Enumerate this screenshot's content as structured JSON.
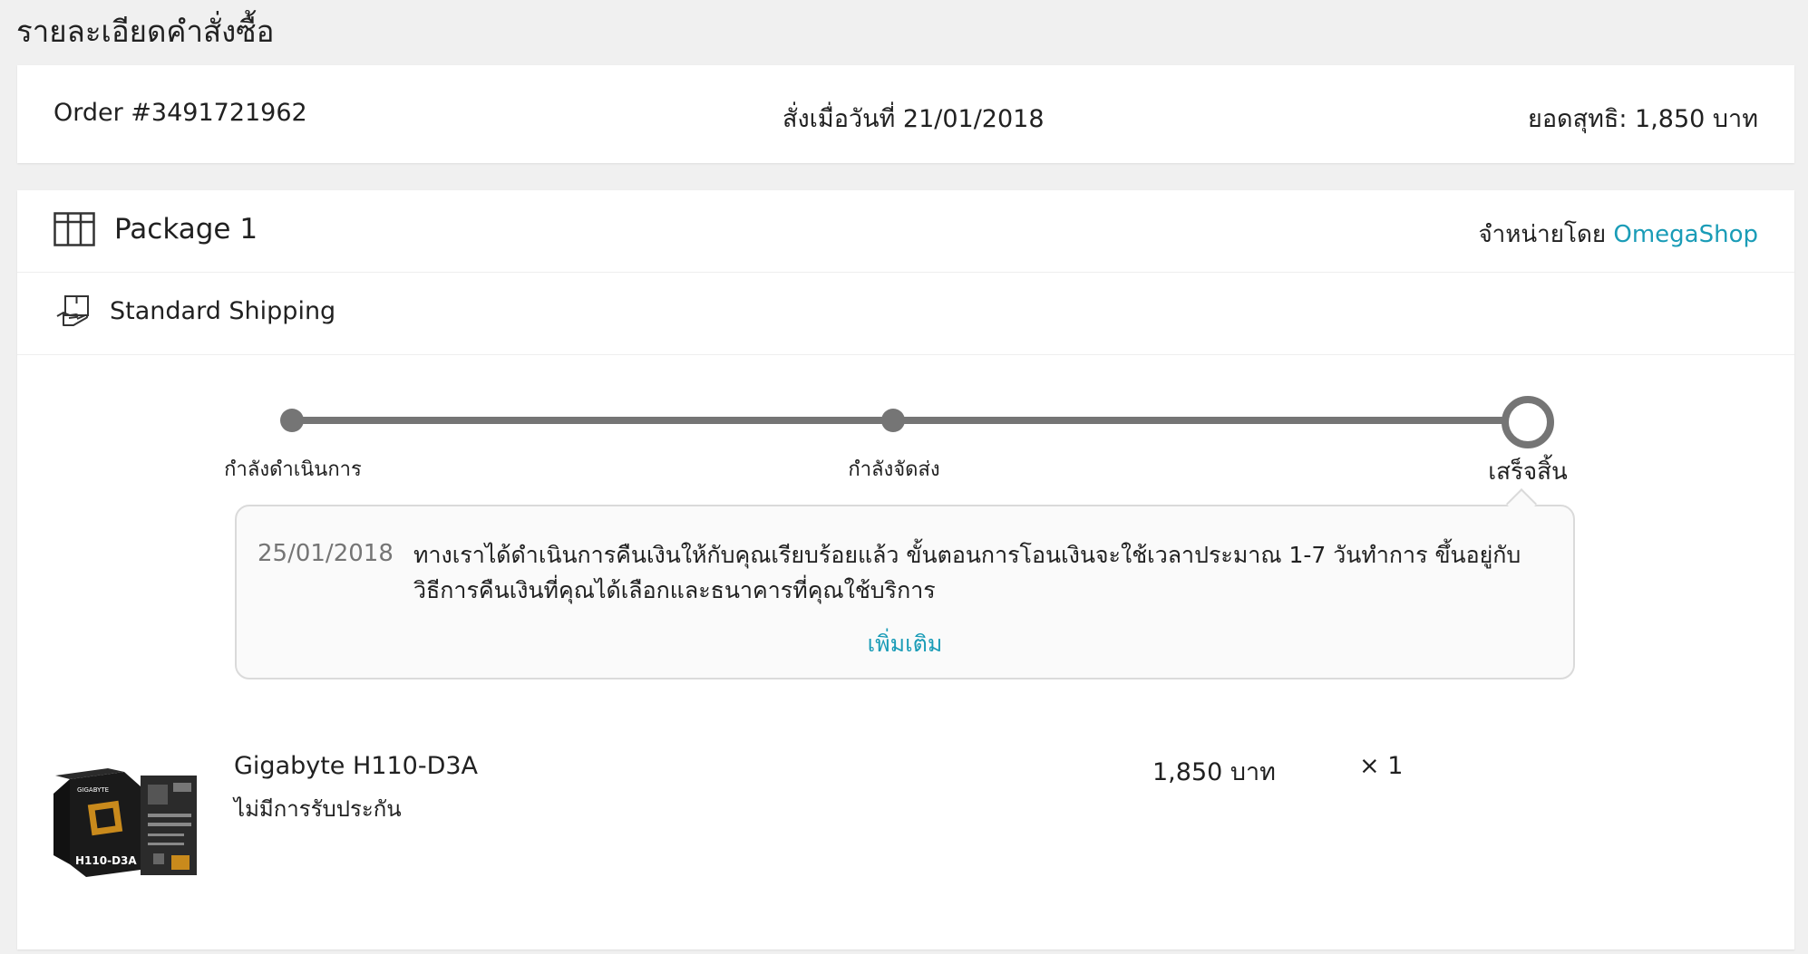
{
  "page": {
    "title": "รายละเอียดคำสั่งซื้อ"
  },
  "order": {
    "number": "Order #3491721962",
    "placed_on": "สั่งเมื่อวันที่ 21/01/2018",
    "total": "ยอดสุทธิ: 1,850 บาท"
  },
  "package": {
    "title": "Package 1",
    "sold_by_label": "จำหน่ายโดย",
    "seller": "OmegaShop",
    "shipping": "Standard Shipping",
    "steps": [
      {
        "label": "กำลังดำเนินการ"
      },
      {
        "label": "กำลังจัดส่ง"
      },
      {
        "label": "เสร็จสิ้น"
      }
    ],
    "current_step": 3,
    "event": {
      "date": "25/01/2018",
      "text": "ทางเราได้ดำเนินการคืนเงินให้กับคุณเรียบร้อยแล้ว ขั้นตอนการโอนเงินจะใช้เวลาประมาณ 1-7 วันทำการ ขึ้นอยู่กับวิธีการคืนเงินที่คุณได้เลือกและธนาคารที่คุณใช้บริการ",
      "more_label": "เพิ่มเติม"
    },
    "item": {
      "name": "Gigabyte H110-D3A",
      "warranty": "ไม่มีการรับประกัน",
      "price": "1,850 บาท",
      "quantity": "× 1",
      "image_brand": "GIGABYTE",
      "image_model": "H110-D3A"
    }
  },
  "colors": {
    "accent": "#1a9cb7",
    "track": "#757575",
    "text": "#212121",
    "muted": "#757575"
  },
  "icons": {
    "package": "package-icon",
    "shipping": "delivery-hand-icon"
  }
}
